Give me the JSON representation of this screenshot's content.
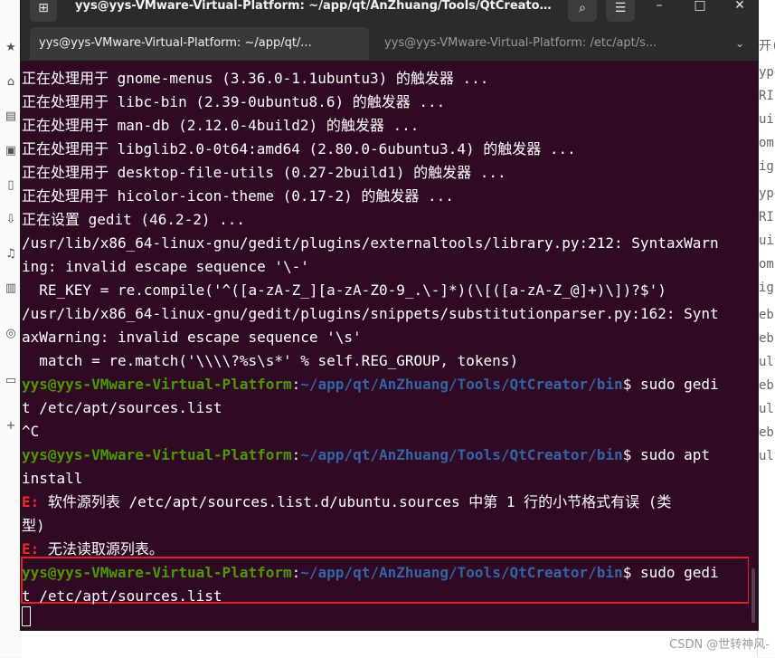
{
  "window": {
    "title": "yys@yys-VMware-Virtual-Platform: ~/app/qt/AnZhuang/Tools/QtCreator/..."
  },
  "tabs": [
    {
      "label": "yys@yys-VMware-Virtual-Platform: ~/app/qt/...",
      "active": true
    },
    {
      "label": "yys@yys-VMware-Virtual-Platform: /etc/apt/s...",
      "active": false
    }
  ],
  "terminal": {
    "lines": [
      [
        {
          "t": "正在处理用于 gnome-menus (3.36.0-1.1ubuntu3) 的触发器 ...",
          "c": "w"
        }
      ],
      [
        {
          "t": "正在处理用于 libc-bin (2.39-0ubuntu8.6) 的触发器 ...",
          "c": "w"
        }
      ],
      [
        {
          "t": "正在处理用于 man-db (2.12.0-4build2) 的触发器 ...",
          "c": "w"
        }
      ],
      [
        {
          "t": "正在处理用于 libglib2.0-0t64:amd64 (2.80.0-6ubuntu3.4) 的触发器 ...",
          "c": "w"
        }
      ],
      [
        {
          "t": "正在处理用于 desktop-file-utils (0.27-2build1) 的触发器 ...",
          "c": "w"
        }
      ],
      [
        {
          "t": "正在处理用于 hicolor-icon-theme (0.17-2) 的触发器 ...",
          "c": "w"
        }
      ],
      [
        {
          "t": "正在设置 gedit (46.2-2) ...",
          "c": "w"
        }
      ],
      [
        {
          "t": "/usr/lib/x86_64-linux-gnu/gedit/plugins/externaltools/library.py:212: SyntaxWarn",
          "c": "w"
        }
      ],
      [
        {
          "t": "ing: invalid escape sequence '\\-'",
          "c": "w"
        }
      ],
      [
        {
          "t": "  RE_KEY = re.compile('^([a-zA-Z_][a-zA-Z0-9_.\\-]*)(\\[([a-zA-Z_@]+)\\])?$')",
          "c": "w"
        }
      ],
      [
        {
          "t": "/usr/lib/x86_64-linux-gnu/gedit/plugins/snippets/substitutionparser.py:162: Synt",
          "c": "w"
        }
      ],
      [
        {
          "t": "axWarning: invalid escape sequence '\\s'",
          "c": "w"
        }
      ],
      [
        {
          "t": "  match = re.match('\\\\\\\\?%s\\s*' % self.REG_GROUP, tokens)",
          "c": "w"
        }
      ],
      [
        {
          "t": "yys@yys-VMware-Virtual-Platform",
          "c": "g"
        },
        {
          "t": ":",
          "c": "w"
        },
        {
          "t": "~/app/qt/AnZhuang/Tools/QtCreator/bin",
          "c": "b"
        },
        {
          "t": "$ sudo gedi",
          "c": "w"
        }
      ],
      [
        {
          "t": "t /etc/apt/sources.list",
          "c": "w"
        }
      ],
      [
        {
          "t": "^C",
          "c": "w"
        }
      ],
      [
        {
          "t": "yys@yys-VMware-Virtual-Platform",
          "c": "g"
        },
        {
          "t": ":",
          "c": "w"
        },
        {
          "t": "~/app/qt/AnZhuang/Tools/QtCreator/bin",
          "c": "b"
        },
        {
          "t": "$ sudo apt",
          "c": "w"
        }
      ],
      [
        {
          "t": "install",
          "c": "w"
        }
      ],
      [
        {
          "t": "E: ",
          "c": "r"
        },
        {
          "t": "软件源列表 /etc/apt/sources.list.d/ubuntu.sources 中第 1 行的小节格式有误 (类",
          "c": "w"
        }
      ],
      [
        {
          "t": "型)",
          "c": "w"
        }
      ],
      [
        {
          "t": "E: ",
          "c": "r"
        },
        {
          "t": "无法读取源列表。",
          "c": "w"
        }
      ],
      [
        {
          "t": "yys@yys-VMware-Virtual-Platform",
          "c": "g"
        },
        {
          "t": ":",
          "c": "w"
        },
        {
          "t": "~/app/qt/AnZhuang/Tools/QtCreator/bin",
          "c": "b"
        },
        {
          "t": "$ sudo gedi",
          "c": "w"
        }
      ],
      [
        {
          "t": "t /etc/apt/sources.list",
          "c": "w"
        }
      ]
    ]
  },
  "background": {
    "right_fragments": [
      "开(",
      "ype",
      "RIs",
      "uit",
      "omp",
      "igr",
      "ype",
      "RIs",
      "uit",
      "omp",
      "igr",
      "eb",
      "eb",
      "ult",
      "eb",
      "ult",
      "eb",
      "ult"
    ],
    "watermark": "CSDN @世转神风-"
  },
  "colors": {
    "terminal_bg": "#300a24",
    "prompt_user": "#4e9a06",
    "prompt_path": "#3465a4",
    "error": "#ef2929",
    "highlight_box": "#e21f26"
  },
  "icons": {
    "new_tab": "new-tab-icon",
    "search": "search-icon",
    "menu": "hamburger-menu-icon",
    "minimize": "minimize-icon",
    "maximize": "maximize-icon",
    "close": "close-icon"
  }
}
